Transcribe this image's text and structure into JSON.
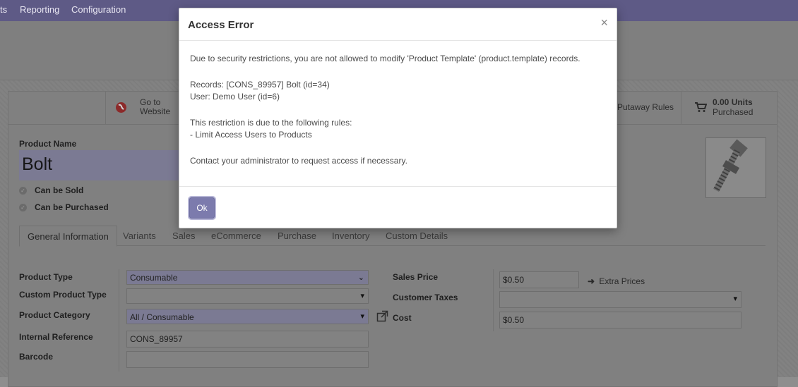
{
  "nav": {
    "item_partial": "ts",
    "reporting": "Reporting",
    "configuration": "Configuration"
  },
  "smart_buttons": {
    "website_line1": "Go to",
    "website_line2": "Website",
    "putaway": "Putaway Rules",
    "purchased_value": "0.00 Units",
    "purchased_label": "Purchased"
  },
  "product": {
    "name_label": "Product Name",
    "name": "Bolt",
    "can_be_sold": "Can be Sold",
    "can_be_purchased": "Can be Purchased"
  },
  "tabs": [
    "General Information",
    "Variants",
    "Sales",
    "eCommerce",
    "Purchase",
    "Inventory",
    "Custom Details"
  ],
  "form": {
    "product_type_label": "Product Type",
    "product_type": "Consumable",
    "custom_product_type_label": "Custom Product Type",
    "custom_product_type": "",
    "product_category_label": "Product Category",
    "product_category": "All / Consumable",
    "internal_reference_label": "Internal Reference",
    "internal_reference": "CONS_89957",
    "barcode_label": "Barcode",
    "barcode": "",
    "sales_price_label": "Sales Price",
    "sales_price": "$0.50",
    "extra_prices": "Extra Prices",
    "customer_taxes_label": "Customer Taxes",
    "customer_taxes": "",
    "cost_label": "Cost",
    "cost": "$0.50"
  },
  "dialog": {
    "title": "Access Error",
    "close": "×",
    "line1": "Due to security restrictions, you are not allowed to modify 'Product Template' (product.template) records.",
    "line2": "Records: [CONS_89957] Bolt (id=34)",
    "line3": "User: Demo User (id=6)",
    "line4": "This restriction is due to the following rules:",
    "line5": "- Limit Access Users to Products",
    "line6": "Contact your administrator to request access if necessary.",
    "ok": "Ok"
  },
  "colors": {
    "nav": "#5e5a86",
    "primary": "#7c7bad",
    "overlay": "#808080"
  }
}
